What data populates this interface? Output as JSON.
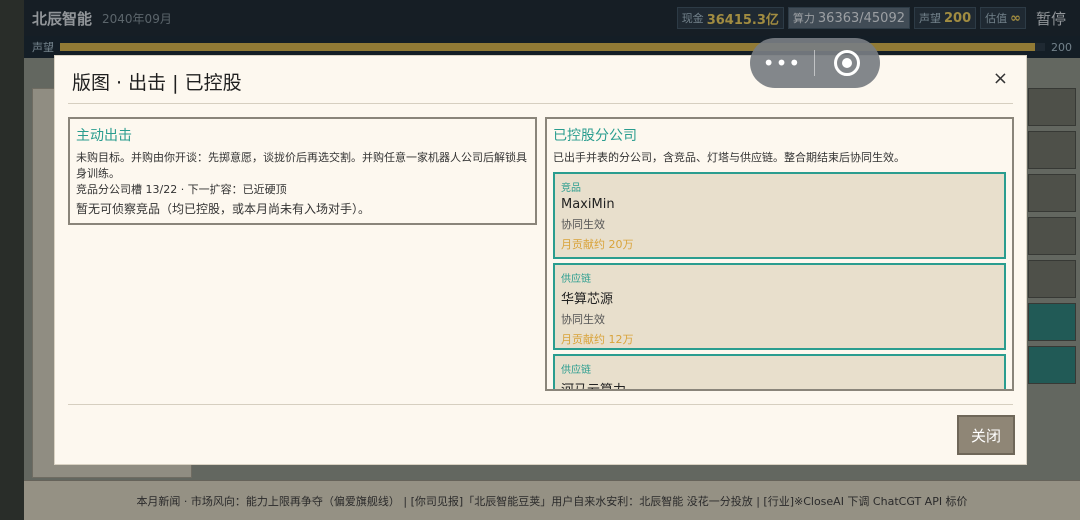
{
  "topbar": {
    "brand": "北辰智能",
    "date": "2040年09月",
    "cash_label": "现金",
    "cash_value": "36415.3亿",
    "compute_label": "算力",
    "compute_value": "36363/45092",
    "reputation_label": "声望",
    "reputation_value": "200",
    "valuation_label": "估值",
    "valuation_value": "∞",
    "pause_label": "暂停"
  },
  "reputation_bar": {
    "label": "声望",
    "value": "200",
    "fill_fraction": 0.99
  },
  "modal": {
    "title": "版图 · 出击 | 已控股",
    "close_x": "×",
    "close_button": "关闭",
    "left_panel": {
      "title": "主动出击",
      "description": "未购目标。并购由你开谈：先掷意愿，谈拢价后再选交割。并购任意一家机器人公司后解锁具身训练。",
      "slots": "竞品分公司槽 13/22 · 下一扩容：已近硬顶",
      "empty_note": "暂无可侦察竞品（均已控股，或本月尚未有入场对手）。"
    },
    "right_panel": {
      "title": "已控股分公司",
      "description": "已出手并表的分公司，含竞品、灯塔与供应链。整合期结束后协同生效。",
      "companies": [
        {
          "category": "竞品",
          "name": "MaxiMin",
          "status": "协同生效",
          "contribution": "月贡献约 20万"
        },
        {
          "category": "供应链",
          "name": "华算芯源",
          "status": "协同生效",
          "contribution": "月贡献约 12万"
        },
        {
          "category": "供应链",
          "name": "河马云算力",
          "status": "",
          "contribution": ""
        }
      ]
    }
  },
  "ticker": {
    "text": "本月新闻 · 市场风向：能力上限再争夺（偏爱旗舰线） | [你司见报]「北辰智能豆荚」用户自来水安利：北辰智能 没花一分投放 | [行业]※CloseAI 下调 ChatCGT API 标价"
  },
  "capsule": {
    "more_icon": "•••",
    "close_icon": "target-circle"
  },
  "colors": {
    "accent": "#2a9d8f",
    "contribution": "#d9a33a",
    "modal_bg": "#fdf8ef",
    "card_bg": "#e8dfcc"
  }
}
